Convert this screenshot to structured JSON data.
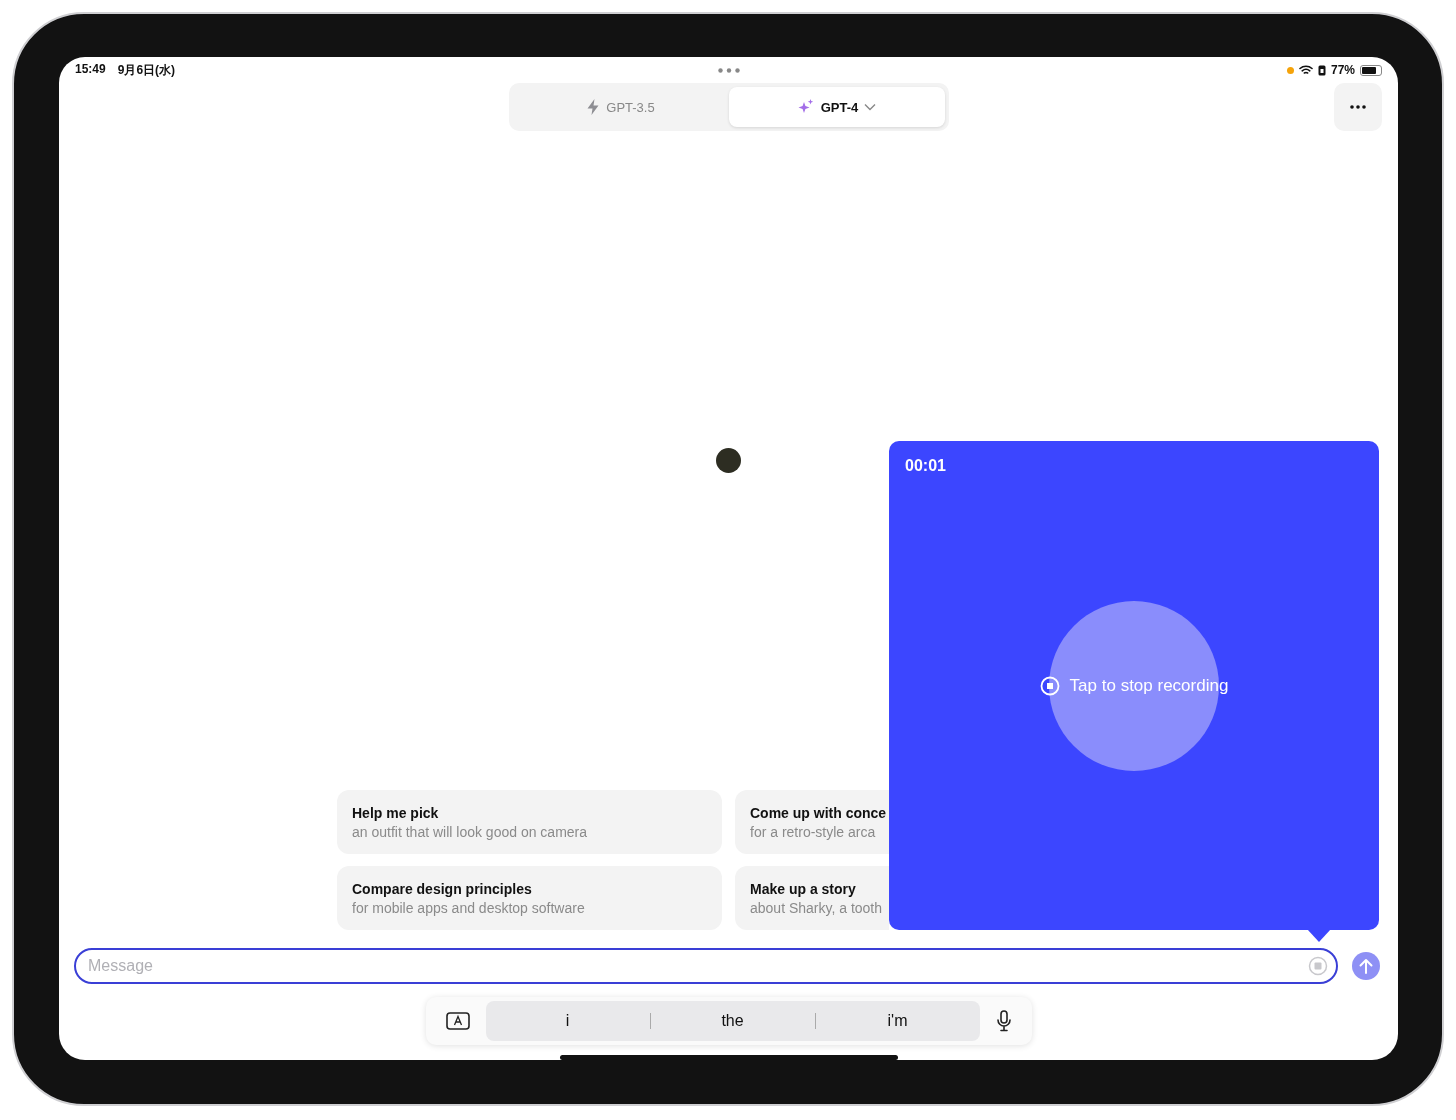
{
  "status_bar": {
    "time": "15:49",
    "date": "9月6日(水)",
    "battery": "77%"
  },
  "model_tabs": [
    {
      "label": "GPT-3.5",
      "kind": "bolt",
      "selected": false
    },
    {
      "label": "GPT-4",
      "kind": "sparkles",
      "selected": true
    }
  ],
  "suggestions": [
    {
      "title": "Help me pick",
      "subtitle": "an outfit that will look good on camera"
    },
    {
      "title": "Come up with conce",
      "subtitle": "for a retro-style arca"
    },
    {
      "title": "Compare design principles",
      "subtitle": "for mobile apps and desktop software"
    },
    {
      "title": "Make up a story",
      "subtitle": "about Sharky, a tooth"
    }
  ],
  "message_field": {
    "placeholder": "Message"
  },
  "keyboard_suggestions": [
    "i",
    "the",
    "i'm"
  ],
  "recording": {
    "timer": "00:01",
    "label": "Tap to stop recording"
  }
}
